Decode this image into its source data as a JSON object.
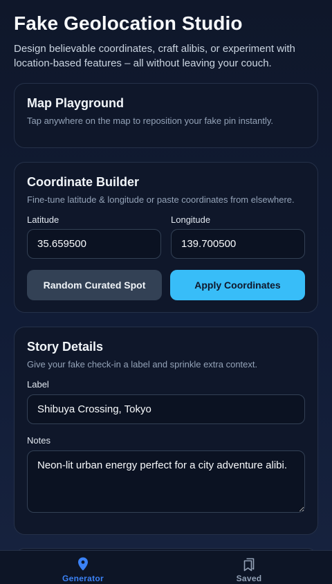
{
  "header": {
    "title": "Fake Geolocation Studio",
    "subtitle": "Design believable coordinates, craft alibis, or experiment with location-based features – all without leaving your couch."
  },
  "map_card": {
    "title": "Map Playground",
    "description": "Tap anywhere on the map to reposition your fake pin instantly."
  },
  "coord_card": {
    "title": "Coordinate Builder",
    "description": "Fine-tune latitude & longitude or paste coordinates from elsewhere.",
    "latitude_label": "Latitude",
    "latitude_value": "35.659500",
    "longitude_label": "Longitude",
    "longitude_value": "139.700500",
    "random_button": "Random Curated Spot",
    "apply_button": "Apply Coordinates"
  },
  "story_card": {
    "title": "Story Details",
    "description": "Give your fake check-in a label and sprinkle extra context.",
    "label_label": "Label",
    "label_value": "Shibuya Crossing, Tokyo",
    "notes_label": "Notes",
    "notes_value": "Neon-lit urban energy perfect for a city adventure alibi."
  },
  "bottom_nav": {
    "items": [
      {
        "label": "Generator",
        "icon": "map-pin-icon",
        "active": true
      },
      {
        "label": "Saved",
        "icon": "bookmarks-icon",
        "active": false
      }
    ]
  },
  "colors": {
    "accent": "#38bdf8",
    "nav_active": "#3b82f6",
    "background": "#0f172a"
  }
}
